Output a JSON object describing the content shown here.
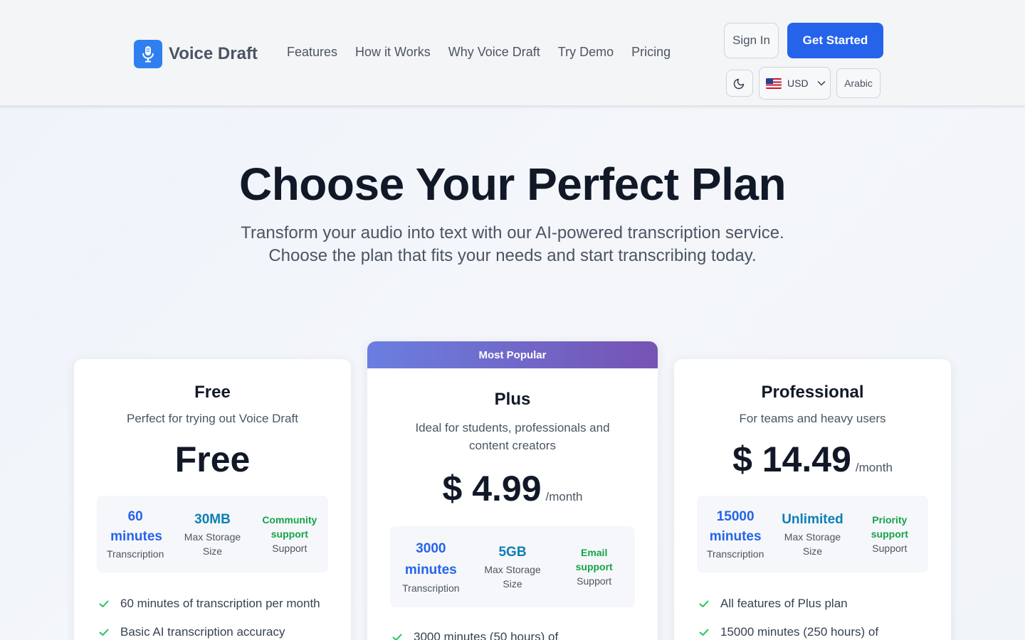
{
  "header": {
    "logo_text": "Voice Draft",
    "nav": [
      "Features",
      "How it Works",
      "Why Voice Draft",
      "Try Demo",
      "Pricing"
    ],
    "sign_in": "Sign In",
    "get_started": "Get Started",
    "currency": "USD",
    "language": "Arabic"
  },
  "hero": {
    "title": "Choose Your Perfect Plan",
    "subtitle": "Transform your audio into text with our AI-powered transcription service. Choose the plan that fits your needs and start transcribing today."
  },
  "plans": [
    {
      "name": "Free",
      "description": "Perfect for trying out Voice Draft",
      "price": "Free",
      "period": "",
      "stats": [
        {
          "value": "60 minutes",
          "label": "Transcription"
        },
        {
          "value": "30MB",
          "label": "Max Storage Size"
        },
        {
          "value": "Community support",
          "label": "Support"
        }
      ],
      "features": [
        "60 minutes of transcription per month",
        "Basic AI transcription accuracy"
      ]
    },
    {
      "badge": "Most Popular",
      "name": "Plus",
      "description": "Ideal for students, professionals and content creators",
      "price": "$ 4.99",
      "period": "/month",
      "stats": [
        {
          "value": "3000 minutes",
          "label": "Transcription"
        },
        {
          "value": "5GB",
          "label": "Max Storage Size"
        },
        {
          "value": "Email support",
          "label": "Support"
        }
      ],
      "features": [
        "3000 minutes (50 hours) of"
      ]
    },
    {
      "name": "Professional",
      "description": "For teams and heavy users",
      "price": "$ 14.49",
      "period": "/month",
      "stats": [
        {
          "value": "15000 minutes",
          "label": "Transcription"
        },
        {
          "value": "Unlimited",
          "label": "Max Storage Size"
        },
        {
          "value": "Priority support",
          "label": "Support"
        }
      ],
      "features": [
        "All features of Plus plan",
        "15000 minutes (250 hours) of"
      ]
    }
  ],
  "colors": {
    "primary": "#2563eb",
    "storage": "#0e7fb5",
    "support": "#16a34a",
    "badge_start": "#6a7fe0",
    "badge_end": "#7653b3"
  }
}
